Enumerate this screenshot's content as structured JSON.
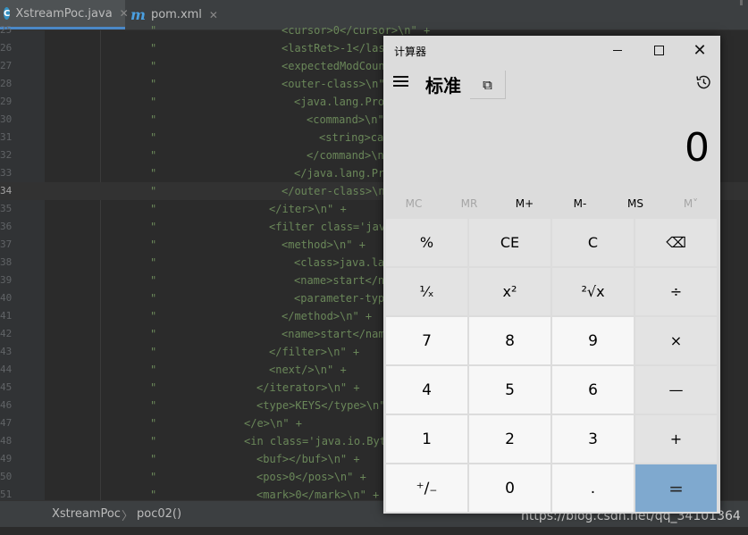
{
  "ide": {
    "tabs": [
      {
        "label": "XstreamPoc.java",
        "icon": "java-class-icon",
        "icon_glyph": "C",
        "active": true
      },
      {
        "label": "pom.xml",
        "icon": "maven-icon",
        "icon_glyph": "m",
        "active": false
      }
    ],
    "close_glyph": "✕",
    "quote": "\"",
    "lines": [
      {
        "n": "25",
        "code": "<cursor>0</cursor>\\n\" +",
        "indent": 315
      },
      {
        "n": "26",
        "code": "<lastRet>-1</last",
        "indent": 315
      },
      {
        "n": "27",
        "code": "<expectedModCount",
        "indent": 315
      },
      {
        "n": "28",
        "code": "<outer-class>\\n\"",
        "indent": 315
      },
      {
        "n": "29",
        "code": "<java.lang.Proc",
        "indent": 329
      },
      {
        "n": "30",
        "code": "<command>\\n\"",
        "indent": 343
      },
      {
        "n": "31",
        "code": "<string>ca",
        "indent": 357
      },
      {
        "n": "32",
        "code": "</command>\\n",
        "indent": 343
      },
      {
        "n": "33",
        "code": "</java.lang.Pro",
        "indent": 329
      },
      {
        "n": "34",
        "code": "</outer-class>\\n",
        "indent": 315
      },
      {
        "n": "35",
        "code": "</iter>\\n\" +",
        "indent": 301
      },
      {
        "n": "36",
        "code": "<filter class='java",
        "indent": 301
      },
      {
        "n": "37",
        "code": "<method>\\n\" +",
        "indent": 315
      },
      {
        "n": "38",
        "code": "<class>java.lan",
        "indent": 329
      },
      {
        "n": "39",
        "code": "<name>start</na",
        "indent": 329
      },
      {
        "n": "40",
        "code": "<parameter-type",
        "indent": 329
      },
      {
        "n": "41",
        "code": "</method>\\n\" +",
        "indent": 315
      },
      {
        "n": "42",
        "code": "<name>start</nam",
        "indent": 315
      },
      {
        "n": "43",
        "code": "</filter>\\n\" +",
        "indent": 301
      },
      {
        "n": "44",
        "code": "<next/>\\n\" +",
        "indent": 301
      },
      {
        "n": "45",
        "code": "</iterator>\\n\" +",
        "indent": 287
      },
      {
        "n": "46",
        "code": "<type>KEYS</type>\\n\"",
        "indent": 287
      },
      {
        "n": "47",
        "code": "</e>\\n\" +",
        "indent": 273
      },
      {
        "n": "48",
        "code": "<in class='java.io.Byte",
        "indent": 273
      },
      {
        "n": "49",
        "code": "<buf></buf>\\n\" +",
        "indent": 287
      },
      {
        "n": "50",
        "code": "<pos>0</pos>\\n\" +",
        "indent": 287
      },
      {
        "n": "51",
        "code": "<mark>0</mark>\\n\" +",
        "indent": 287
      }
    ],
    "current_line": "34",
    "breadcrumb": [
      "XstreamPoc",
      "poc02()"
    ],
    "breadcrumb_sep": "〉",
    "watermark": "https://blog.csdn.net/qq_34101364",
    "colors": {
      "string": "#6a8759",
      "keyword": "#cc7832",
      "background": "#2b2b2b"
    }
  },
  "calculator": {
    "title": "计算器",
    "window_buttons": {
      "minimize": "min-icon",
      "maximize": "max-icon",
      "close": "✕"
    },
    "mode": "标准",
    "keep_on_top_icon": "⧉",
    "display": "0",
    "memory": [
      {
        "label": "MC",
        "enabled": false
      },
      {
        "label": "MR",
        "enabled": false
      },
      {
        "label": "M+",
        "enabled": true
      },
      {
        "label": "M-",
        "enabled": true
      },
      {
        "label": "MS",
        "enabled": true
      },
      {
        "label": "M˅",
        "enabled": false
      }
    ],
    "keys": [
      {
        "label": "%",
        "kind": "fn",
        "name": "percent-button"
      },
      {
        "label": "CE",
        "kind": "fn",
        "name": "clear-entry-button"
      },
      {
        "label": "C",
        "kind": "fn",
        "name": "clear-button"
      },
      {
        "label": "⌫",
        "kind": "fn",
        "name": "backspace-button"
      },
      {
        "label": "¹⁄ₓ",
        "kind": "fn",
        "name": "reciprocal-button"
      },
      {
        "label": "x²",
        "kind": "fn",
        "name": "square-button"
      },
      {
        "label": "²√x",
        "kind": "fn",
        "name": "square-root-button"
      },
      {
        "label": "÷",
        "kind": "fn",
        "name": "divide-button"
      },
      {
        "label": "7",
        "kind": "num",
        "name": "digit-7-button"
      },
      {
        "label": "8",
        "kind": "num",
        "name": "digit-8-button"
      },
      {
        "label": "9",
        "kind": "num",
        "name": "digit-9-button"
      },
      {
        "label": "×",
        "kind": "fn",
        "name": "multiply-button"
      },
      {
        "label": "4",
        "kind": "num",
        "name": "digit-4-button"
      },
      {
        "label": "5",
        "kind": "num",
        "name": "digit-5-button"
      },
      {
        "label": "6",
        "kind": "num",
        "name": "digit-6-button"
      },
      {
        "label": "—",
        "kind": "fn",
        "name": "subtract-button"
      },
      {
        "label": "1",
        "kind": "num",
        "name": "digit-1-button"
      },
      {
        "label": "2",
        "kind": "num",
        "name": "digit-2-button"
      },
      {
        "label": "3",
        "kind": "num",
        "name": "digit-3-button"
      },
      {
        "label": "+",
        "kind": "fn",
        "name": "add-button"
      },
      {
        "label": "⁺∕₋",
        "kind": "num",
        "name": "negate-button"
      },
      {
        "label": "0",
        "kind": "num",
        "name": "digit-0-button"
      },
      {
        "label": ".",
        "kind": "num",
        "name": "decimal-button"
      },
      {
        "label": "=",
        "kind": "eq",
        "name": "equals-button"
      }
    ],
    "accent_color": "#7fa9cf"
  }
}
